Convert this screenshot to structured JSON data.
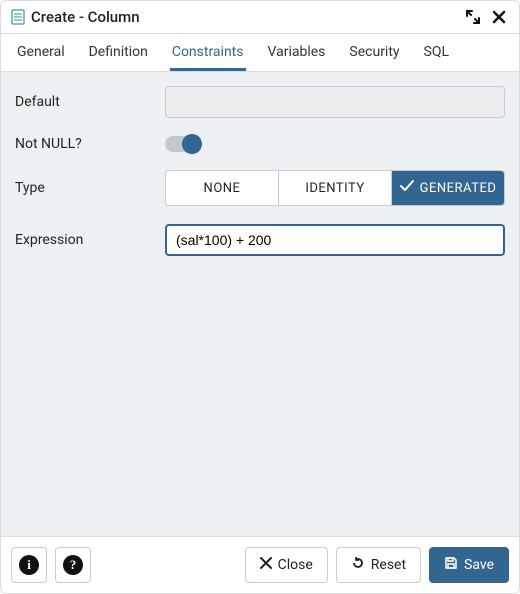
{
  "header": {
    "title": "Create - Column"
  },
  "tabs": [
    {
      "label": "General",
      "active": false
    },
    {
      "label": "Definition",
      "active": false
    },
    {
      "label": "Constraints",
      "active": true
    },
    {
      "label": "Variables",
      "active": false
    },
    {
      "label": "Security",
      "active": false
    },
    {
      "label": "SQL",
      "active": false
    }
  ],
  "form": {
    "default_label": "Default",
    "default_value": "",
    "notnull_label": "Not NULL?",
    "notnull_value": true,
    "type_label": "Type",
    "type_options": {
      "none": "NONE",
      "identity": "IDENTITY",
      "generated": "GENERATED"
    },
    "type_selected": "generated",
    "expression_label": "Expression",
    "expression_value": "(sal*100) + 200"
  },
  "footer": {
    "close_label": "Close",
    "reset_label": "Reset",
    "save_label": "Save"
  }
}
